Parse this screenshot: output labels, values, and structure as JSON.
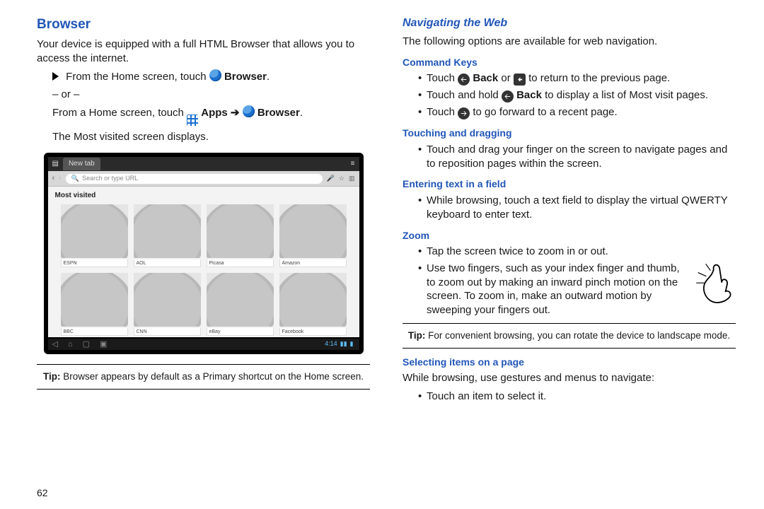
{
  "left": {
    "heading": "Browser",
    "intro": "Your device is equipped with a full HTML Browser that allows you to access the internet.",
    "step1_pre": "From the Home screen, touch ",
    "browser_word": "Browser",
    "period": ".",
    "or": "– or –",
    "step2_pre": "From a Home screen, touch ",
    "apps_word": "Apps",
    "step2_post": "The Most visited screen displays.",
    "tip_label": "Tip:",
    "tip_text": " Browser appears by default as a Primary shortcut on the Home screen.",
    "mock": {
      "tab": "New tab",
      "url_placeholder": "Search or type URL",
      "mv": "Most visited",
      "thumbs": [
        "ESPN",
        "AOL",
        "Picasa",
        "Amazon",
        "BBC",
        "CNN",
        "eBay",
        "Facebook"
      ],
      "clock": "4:14"
    },
    "pagenum": "62"
  },
  "right": {
    "heading": "Navigating the Web",
    "intro": "The following options are available for web navigation.",
    "cmdkeys": {
      "h": "Command Keys",
      "i1a": "Touch ",
      "back": "Back",
      "i1b": " or ",
      "i1c": " to return to the previous page.",
      "i2a": "Touch and hold ",
      "i2b": " to display a list of Most visit pages.",
      "i3a": "Touch ",
      "i3b": " to go forward to a recent page."
    },
    "drag": {
      "h": "Touching and dragging",
      "t": "Touch and drag your finger on the screen to navigate pages and to reposition pages within the screen."
    },
    "entry": {
      "h": "Entering text in a field",
      "t": "While browsing, touch a text field to display the virtual QWERTY keyboard to enter text."
    },
    "zoom": {
      "h": "Zoom",
      "t1": "Tap the screen twice to zoom in or out.",
      "t2": "Use two fingers, such as your index finger and thumb, to zoom out by making an inward pinch motion on the screen. To zoom in, make an outward motion by sweeping your fingers out."
    },
    "tip_label": "Tip:",
    "tip_text": " For convenient browsing, you can rotate the device to landscape mode.",
    "select": {
      "h": "Selecting items on a page",
      "intro": "While browsing, use gestures and menus to navigate:",
      "t1": "Touch an item to select it."
    }
  }
}
